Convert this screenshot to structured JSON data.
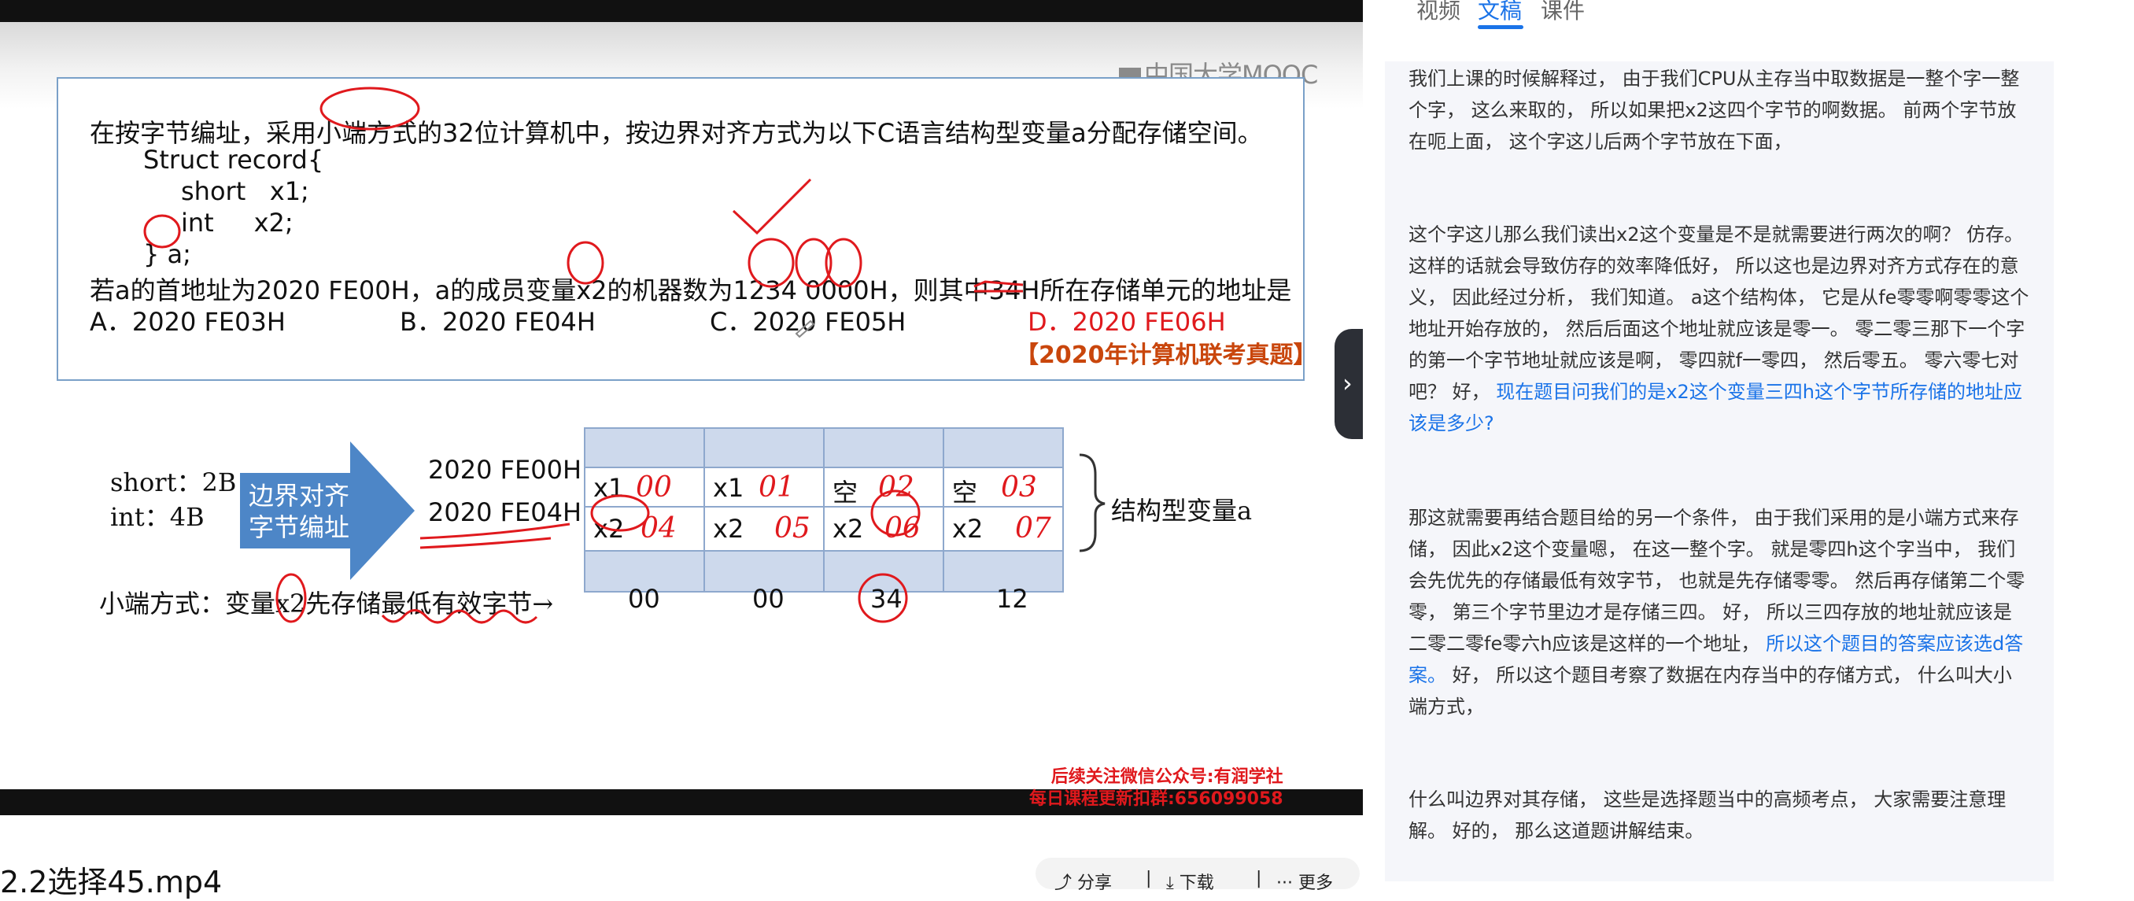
{
  "video": {
    "watermark": "中国大学MOOC",
    "question": {
      "line1": "在按字节编址，采用小端方式的32位计算机中，按边界对齐方式为以下C语言结构型变量a分配存储空间。",
      "code_line1": "Struct record{",
      "code_line2": "short   x1;",
      "code_line3": "int     x2;",
      "code_line4": "} a;",
      "line6": "若a的首地址为2020 FE00H，a的成员变量x2的机器数为1234 0000H，则其中34H所在存储单元的地址是",
      "option_a": "A．2020 FE03H",
      "option_b": "B．2020 FE04H",
      "option_c": "C．2020 FE05H",
      "option_d": "D．2020 FE06H",
      "source": "【2020年计算机联考真题】"
    },
    "diagram": {
      "short_label": "short：2B",
      "int_label": "int：4B",
      "arrow_text": "边界对齐字节编址",
      "addr1": "2020 FE00H",
      "addr2": "2020 FE04H",
      "row1": [
        {
          "name": "x1",
          "note": "00"
        },
        {
          "name": "x1",
          "note": "01"
        },
        {
          "name": "空",
          "note": "02"
        },
        {
          "name": "空",
          "note": "03"
        }
      ],
      "row2": [
        {
          "name": "x2",
          "note": "04"
        },
        {
          "name": "x2",
          "note": "05"
        },
        {
          "name": "x2",
          "note": "06"
        },
        {
          "name": "x2",
          "note": "07"
        }
      ],
      "struct_label": "结构型变量a",
      "little_endian_note": "小端方式：变量x2先存储最低有效字节→",
      "bytes": [
        "00",
        "00",
        "34",
        "12"
      ]
    },
    "promo_line1": "后续关注微信公众号:有润学社",
    "promo_line2": "每日课程更新扣群:656099058"
  },
  "below": {
    "title": "2.2选择45.mp4",
    "share": "分享",
    "download": "下载",
    "more": "更多"
  },
  "tabs": [
    "视频",
    "文稿",
    "课件"
  ],
  "active_tab": "文稿",
  "transcript": {
    "p1": "我们上课的时候解释过， 由于我们CPU从主存当中取数据是一整个字一整个字， 这么来取的， 所以如果把x2这四个字节的啊数据。 前两个字节放在呃上面， 这个字这儿后两个字节放在下面，",
    "p2_a": "这个字这儿那么我们读出x2这个变量是不是就需要进行两次的啊？ 仿存。 这样的话就会导致仿存的效率降低好， 所以这也是边界对齐方式存在的意义， 因此经过分析， 我们知道。 a这个结构体， 它是从fe零零啊零零这个地址开始存放的， 然后后面这个地址就应该是零一。 零二零三那下一个字的第一个字节地址就应该是啊， 零四就f一零四， 然后零五。 零六零七对吧？ 好， ",
    "p2_hl": "现在题目问我们的是x2这个变量三四h这个字节所存储的地址应该是多少?",
    "p3_a": "那这就需要再结合题目给的另一个条件， 由于我们采用的是小端方式来存储， 因此x2这个变量嗯， 在这一整个字。 就是零四h这个字当中， 我们会先优先的存储最低有效字节， 也就是先存储零零。 然后再存储第二个零零， 第三个字节里边才是存储三四。 好， 所以三四存放的地址就应该是二零二零fe零六h应该是这样的一个地址， ",
    "p3_hl": "所以这个题目的答案应该选d答案。",
    "p3_b": " 好， 所以这个题目考察了数据在内存当中的存储方式， 什么叫大小端方式，",
    "p4": "什么叫边界对其存储， 这些是选择题当中的高频考点， 大家需要注意理解。 好的， 那么这道题讲解结束。"
  },
  "colors": {
    "accent": "#1a73e8",
    "annotation": "#e0191d",
    "source": "#c9460c"
  }
}
